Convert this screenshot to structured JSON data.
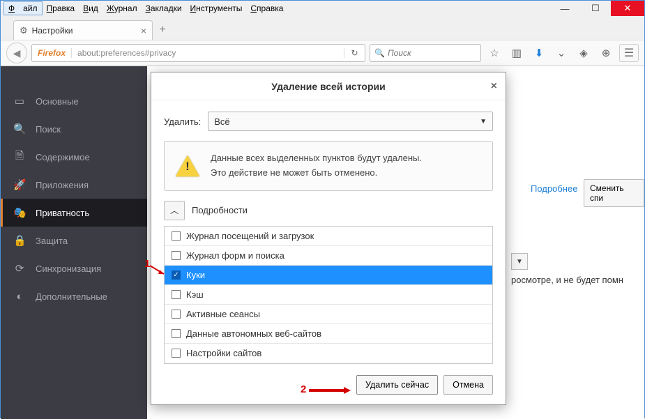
{
  "menu": {
    "items": [
      "Файл",
      "Правка",
      "Вид",
      "Журнал",
      "Закладки",
      "Инструменты",
      "Справка"
    ]
  },
  "tab": {
    "title": "Настройки"
  },
  "url": {
    "brand": "Firefox",
    "address": "about:preferences#privacy"
  },
  "search": {
    "placeholder": "Поиск"
  },
  "sidebar": {
    "items": [
      {
        "icon": "▭",
        "label": "Основные"
      },
      {
        "icon": "🔍",
        "label": "Поиск"
      },
      {
        "icon": "🗎",
        "label": "Содержимое"
      },
      {
        "icon": "🚀",
        "label": "Приложения"
      },
      {
        "icon": "🎭",
        "label": "Приватность"
      },
      {
        "icon": "🔒",
        "label": "Защита"
      },
      {
        "icon": "⟳",
        "label": "Синхронизация"
      },
      {
        "icon": "◐",
        "label": "Дополнительные"
      }
    ]
  },
  "bg": {
    "more": "Подробнее",
    "change": "Сменить спи",
    "tail": "росмотре, и не будет помн"
  },
  "dialog": {
    "title": "Удаление всей истории",
    "delete_label": "Удалить:",
    "delete_value": "Всё",
    "warn1": "Данные всех выделенных пунктов будут удалены.",
    "warn2": "Это действие не может быть отменено.",
    "details": "Подробности",
    "items": [
      {
        "label": "Журнал посещений и загрузок",
        "checked": false,
        "selected": false
      },
      {
        "label": "Журнал форм и поиска",
        "checked": false,
        "selected": false
      },
      {
        "label": "Куки",
        "checked": true,
        "selected": true
      },
      {
        "label": "Кэш",
        "checked": false,
        "selected": false
      },
      {
        "label": "Активные сеансы",
        "checked": false,
        "selected": false
      },
      {
        "label": "Данные автономных веб-сайтов",
        "checked": false,
        "selected": false
      },
      {
        "label": "Настройки сайтов",
        "checked": false,
        "selected": false
      }
    ],
    "ok": "Удалить сейчас",
    "cancel": "Отмена"
  },
  "annot": {
    "a1": "1",
    "a2": "2"
  }
}
